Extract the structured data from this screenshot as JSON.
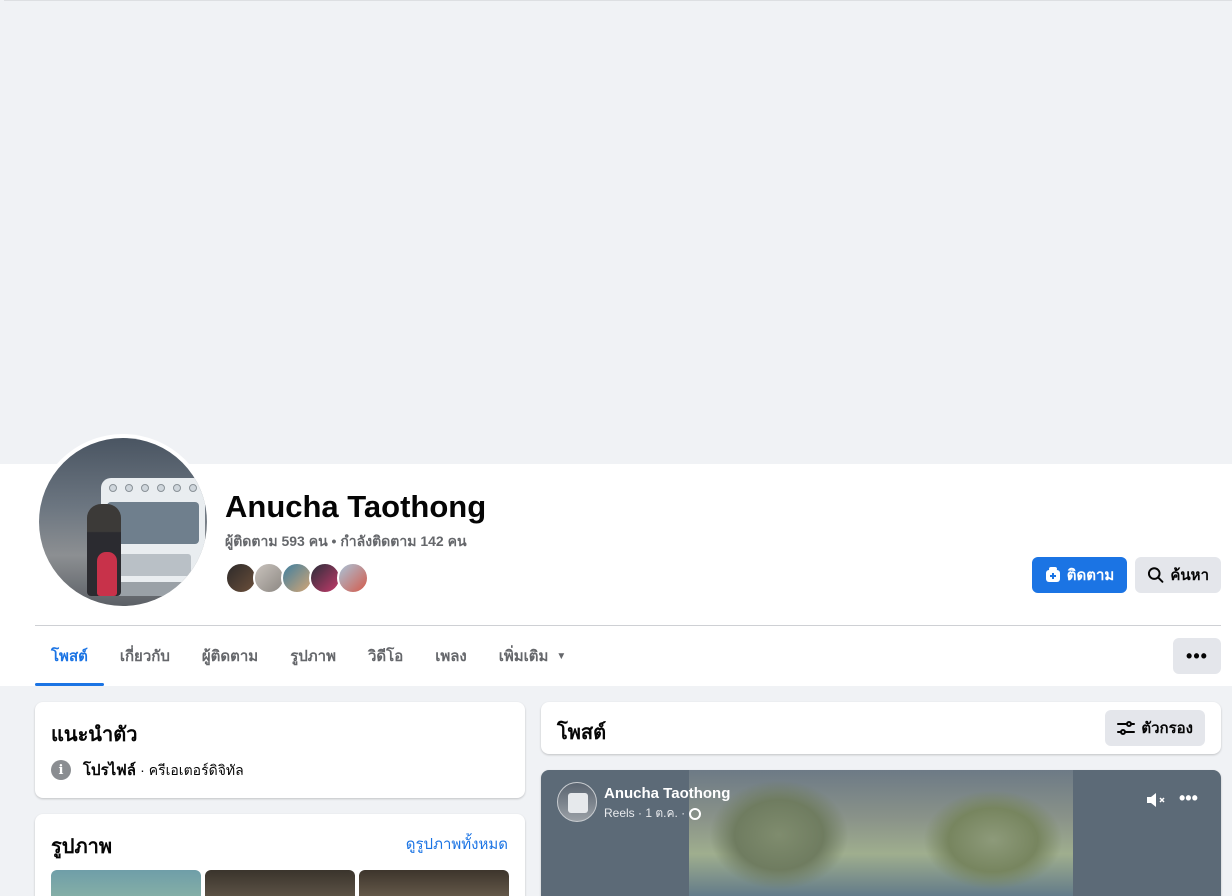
{
  "profile": {
    "name": "Anucha Taothong",
    "stats": "ผู้ติดตาม 593 คน • กำลังติดตาม 142 คน"
  },
  "actions": {
    "follow_label": "ติดตาม",
    "search_label": "ค้นหา",
    "more_label": "•••"
  },
  "tabs": [
    {
      "label": "โพสต์",
      "active": true
    },
    {
      "label": "เกี่ยวกับ"
    },
    {
      "label": "ผู้ติดตาม"
    },
    {
      "label": "รูปภาพ"
    },
    {
      "label": "วิดีโอ"
    },
    {
      "label": "เพลง"
    },
    {
      "label": "เพิ่มเติม",
      "dropdown": true
    }
  ],
  "intro": {
    "title": "แนะนำตัว",
    "row_label": "โปรไฟล์",
    "row_value": "· ครีเอเตอร์ดิจิทัล"
  },
  "photos": {
    "title": "รูปภาพ",
    "see_all": "ดูรูปภาพทั้งหมด"
  },
  "posts": {
    "title": "โพสต์",
    "filter_label": "ตัวกรอง"
  },
  "reel": {
    "author": "Anucha Taothong",
    "meta": "Reels · 1 ต.ค. ·"
  },
  "colors": {
    "accent": "#1b74e4",
    "background": "#f0f2f5",
    "secondary_text": "#65676b"
  }
}
